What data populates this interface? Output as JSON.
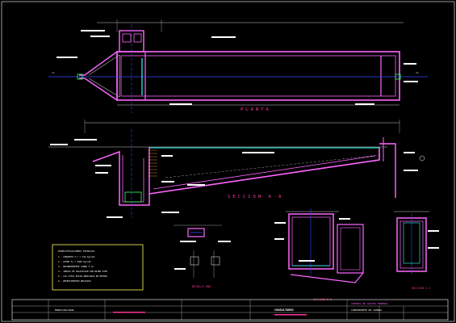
{
  "drawing": {
    "plan_title": "PLANTA",
    "section_aa_title": "SECCION A-A",
    "section_bb_title": "SECCION B-B",
    "section_cc_title": "SECCION C-C",
    "detail_title": "DETALLE UÑA"
  },
  "notes": {
    "title": "ESPECIFICACIONES TECNICAS",
    "lines": [
      "1.- CONCRETO f'c = 210 kg/cm2",
      "2.- ACERO fy = 4200 kg/cm2",
      "3.- RECUBRIMIENTO LIBRE 4 cm",
      "4.- JUNTAS DE DILATACION CON WATER STOP",
      "5.- LAS COTAS ESTAN INDICADAS EN METROS",
      "6.- REVESTIMIENTO ENLUCIDO"
    ]
  },
  "title_block": {
    "project": "CONTROL DE GASTOS TUBERIA",
    "sheet_title": "CONVENIENTE DE CAMARA",
    "owner": "MUNICIPALIDAD",
    "company": "CONSULTORES"
  },
  "colors": {
    "background": "#000000",
    "outline": "#ff66ff",
    "dimension": "#ffffff",
    "axis": "#3344ff",
    "hatch": "#ff9933",
    "label": "#ff3399",
    "note_box": "#ffff66",
    "green": "#33ff66",
    "cyan": "#33ffff"
  }
}
